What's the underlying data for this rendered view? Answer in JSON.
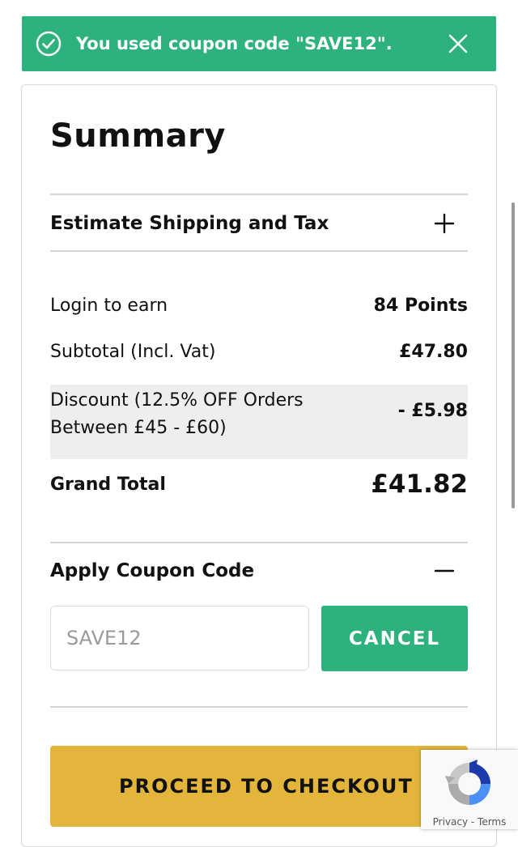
{
  "notice": {
    "message": "You used coupon code \"SAVE12\"."
  },
  "summary": {
    "title": "Summary",
    "shipping_label": "Estimate Shipping and Tax",
    "points_label": "Login to earn",
    "points_value": "84 Points",
    "subtotal_label": "Subtotal (Incl. Vat)",
    "subtotal_value": "£47.80",
    "discount_label": "Discount (12.5% OFF Orders Between £45 - £60)",
    "discount_value": "- £5.98",
    "grand_total_label": "Grand Total",
    "grand_total_value": "£41.82"
  },
  "coupon": {
    "heading": "Apply Coupon Code",
    "input_value": "SAVE12",
    "cancel_label": "CANCEL"
  },
  "checkout": {
    "label": "PROCEED TO CHECKOUT"
  },
  "recaptcha": {
    "privacy": "Privacy",
    "separator": " - ",
    "terms": "Terms"
  },
  "colors": {
    "accent_green": "#2db27d",
    "checkout_yellow": "#e3b53a",
    "discount_bg": "#eeeeee"
  }
}
